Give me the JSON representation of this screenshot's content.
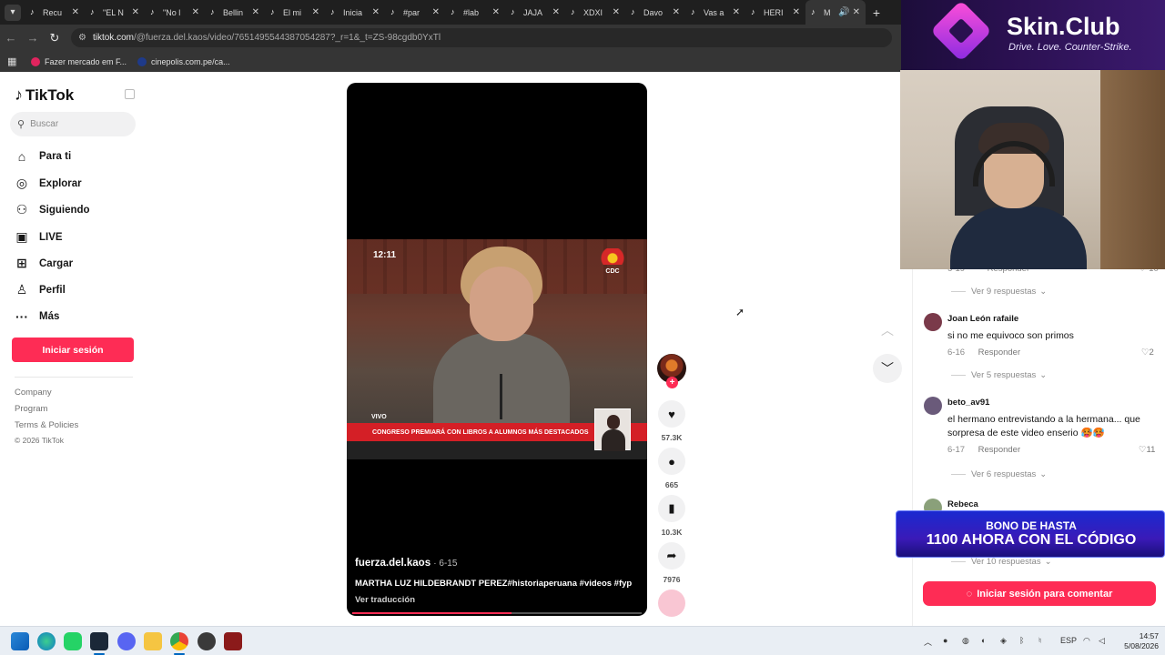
{
  "browser": {
    "tabs": [
      {
        "title": "Recu"
      },
      {
        "title": "\"EL N"
      },
      {
        "title": "\"No l"
      },
      {
        "title": "Bellin"
      },
      {
        "title": "El mi"
      },
      {
        "title": "Inicia"
      },
      {
        "title": "#par"
      },
      {
        "title": "#lab"
      },
      {
        "title": "JAJA"
      },
      {
        "title": "XDXI"
      },
      {
        "title": "Davo"
      },
      {
        "title": "Vas a"
      },
      {
        "title": "HERI"
      },
      {
        "title": "M"
      }
    ],
    "url_host": "tiktok.com",
    "url_path": "/@fuerza.del.kaos/video/7651495544387054287?_r=1&_t=ZS-98cgdb0YxTl",
    "bookmarks": [
      {
        "label": "Fazer mercado em F...",
        "color": "#e0245e"
      },
      {
        "label": "cinepolis.com.pe/ca...",
        "color": "#1e3a8a"
      }
    ]
  },
  "sidebar": {
    "logo": "TikTok",
    "search_placeholder": "Buscar",
    "nav": [
      {
        "label": "Para ti",
        "icon": "home-icon"
      },
      {
        "label": "Explorar",
        "icon": "compass-icon"
      },
      {
        "label": "Siguiendo",
        "icon": "following-icon"
      },
      {
        "label": "LIVE",
        "icon": "live-icon"
      },
      {
        "label": "Cargar",
        "icon": "upload-icon"
      },
      {
        "label": "Perfil",
        "icon": "profile-icon"
      },
      {
        "label": "Más",
        "icon": "more-icon"
      }
    ],
    "login_label": "Iniciar sesión",
    "footer": [
      "Company",
      "Program",
      "Terms & Policies"
    ],
    "copyright": "© 2026 TikTok"
  },
  "video": {
    "timestamp": "12:11",
    "channel_logo": "CDC",
    "live_label": "VIVO",
    "lower_third": "CONGRESO PREMIARÁ CON LIBROS A ALUMNOS MÁS DESTACADOS",
    "author": "fuerza.del.kaos",
    "date": "6-15",
    "caption": "MARTHA LUZ HILDEBRANDT PEREZ#historiaperuana #videos #fyp",
    "translate": "Ver traducción",
    "progress": 0.55
  },
  "actions": {
    "likes": "57.3K",
    "comments": "665",
    "saves": "10.3K",
    "shares": "7976"
  },
  "comments": {
    "partial_date": "6-19",
    "partial_reply": "Responder",
    "partial_likes": "10",
    "items": [
      {
        "replies_label": "Ver 9 respuestas"
      },
      {
        "user": "Joan León rafaile",
        "text": "si no me equivoco son primos",
        "date": "6-16",
        "reply": "Responder",
        "likes": "2",
        "replies_label": "Ver 5 respuestas",
        "avatar_color": "#7a3a4a"
      },
      {
        "user": "beto_av91",
        "text": "el hermano entrevistando a la hermana... que sorpresa de este video enserio 🥵🥵",
        "date": "6-17",
        "reply": "Responder",
        "likes": "11",
        "replies_label": "Ver 6 respuestas",
        "avatar_color": "#6a5a7a"
      },
      {
        "user": "Rebeca",
        "replies_label": "Ver 10 respuestas",
        "avatar_color": "#8aa07a"
      }
    ],
    "cta": "Iniciar sesión para comentar"
  },
  "overlay": {
    "brand_name": "Skin.Club",
    "brand_tagline": "Drive. Love. Counter-Strike.",
    "promo_line1": "BONO DE HASTA",
    "promo_line2": "1100 AHORA CON EL CÓDIGO"
  },
  "taskbar": {
    "lang": "ESP",
    "time": "14:57",
    "date": "5/08/2026"
  }
}
